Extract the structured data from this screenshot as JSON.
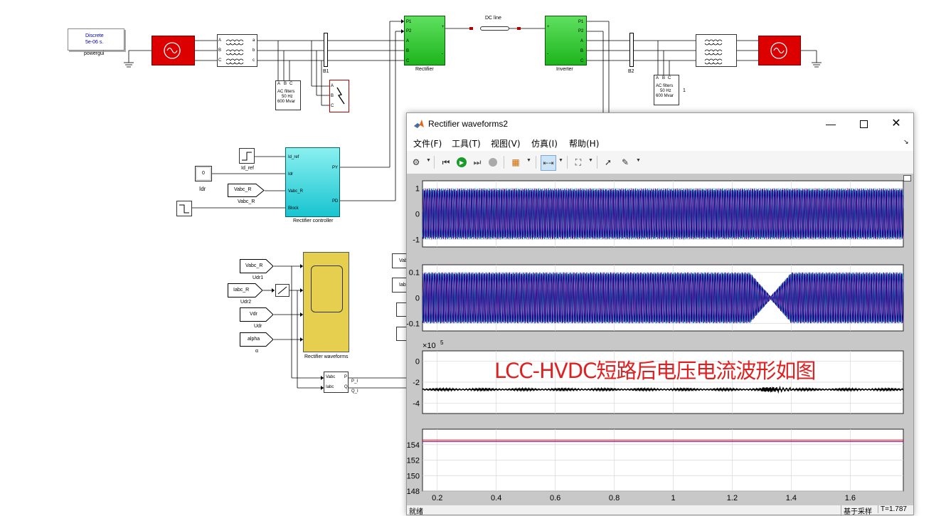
{
  "model": {
    "powergui": {
      "line1": "Discrete",
      "line2": "5e-06 s.",
      "name": "powergui"
    },
    "dc_line_label": "DC line",
    "rectifier_label": "Rectifier",
    "inverter_label": "Inverter",
    "b1_label": "B1",
    "b2_label": "B2",
    "ac_filter_left": {
      "line1": "AC filters",
      "line2": "50 Hz",
      "line3": "600 Mvar",
      "ports": [
        "A",
        "B",
        "C"
      ]
    },
    "ac_filter_right": {
      "line1": "AC filters",
      "line2": "50 Hz",
      "line3": "600 Mvar",
      "ports": [
        "A",
        "B",
        "C"
      ],
      "side": "1"
    },
    "fault_ports": [
      "A",
      "B",
      "C"
    ],
    "rect_ports_left": [
      "P1",
      "P2",
      "A",
      "B",
      "C"
    ],
    "rect_ports_right": [
      "+",
      "-"
    ],
    "inv_ports_left": [
      "+",
      "-"
    ],
    "inv_ports_right": [
      "P1",
      "P2",
      "A",
      "B",
      "C"
    ],
    "transformer_ports": [
      "A",
      "B",
      "C",
      "a",
      "b",
      "c"
    ],
    "source_ports": [
      "A",
      "B",
      "C"
    ],
    "id_ref": "Id_ref",
    "idr_display": {
      "value": "0",
      "label": "Idr"
    },
    "vabc_r_goto": {
      "text": "Vabc_R",
      "label": "Vabc_R"
    },
    "controller": {
      "name": "Rectifier controller",
      "inputs": [
        "Id_ref",
        "Idr",
        "Vabc_R",
        "Block"
      ],
      "outputs": [
        "PY",
        "PD"
      ]
    },
    "from_blocks": [
      {
        "text": "Vabc_R",
        "label": "Udr1"
      },
      {
        "text": "Iabc_R",
        "label": "Udr2"
      },
      {
        "text": "Vdr",
        "label": "Udr"
      },
      {
        "text": "alpha",
        "label": "α"
      }
    ],
    "scope_name": "Rectifier waveforms",
    "pq_block": {
      "inputs": [
        "Vabc",
        "Iabc"
      ],
      "outputs": [
        "P",
        "Q"
      ],
      "out_labels": [
        "P_I",
        "Q_I"
      ]
    },
    "partial_from": [
      "Vab",
      "Iab"
    ]
  },
  "window": {
    "title": "Rectifier waveforms2",
    "menus": [
      "文件(F)",
      "工具(T)",
      "视图(V)",
      "仿真(I)",
      "帮助(H)"
    ],
    "status_left": "就绪",
    "status_mid": "基于采样",
    "status_right": "T=1.787"
  },
  "overlay_text": "LCC-HVDC短路后电压电流波形如图",
  "chart_data": [
    {
      "type": "line",
      "title": "",
      "ylim": [
        -1.3,
        1.3
      ],
      "yticks": [
        "1",
        "0",
        "-1"
      ],
      "series_colors": [
        "#00c0c0",
        "#8000a0",
        "#000080"
      ],
      "description_values": {
        "amplitude": 1.0
      }
    },
    {
      "type": "line",
      "title": "",
      "ylim": [
        -0.13,
        0.13
      ],
      "yticks": [
        "0.1",
        "0",
        "-0.1"
      ],
      "series_colors": [
        "#00c0c0",
        "#8000a0",
        "#000080"
      ],
      "description_values": {
        "amplitude_before": 0.1,
        "dip_center_x": 1.33,
        "dip_min_amplitude": 0.005
      }
    },
    {
      "type": "line",
      "title": "",
      "ylim": [
        -5,
        1
      ],
      "yticks": [
        "0",
        "-2",
        "-4"
      ],
      "exponent_label": "×10",
      "exponent_power": "5",
      "series": [
        {
          "name": "",
          "values_x": [
            0.15,
            1.3,
            1.4,
            1.78
          ],
          "values_y": [
            -2.7,
            -2.7,
            -2.6,
            -2.7
          ]
        }
      ]
    },
    {
      "type": "line",
      "title": "",
      "ylim": [
        148,
        156
      ],
      "yticks": [
        "154",
        "152",
        "150",
        "148"
      ],
      "xticks": [
        "0.2",
        "0.4",
        "0.6",
        "0.8",
        "1",
        "1.2",
        "1.4",
        "1.6"
      ],
      "xlim": [
        0.15,
        1.78
      ],
      "series": [
        {
          "name": "",
          "color": "#ff0000",
          "values_x": [
            0.15,
            1.78
          ],
          "values_y": [
            154.6,
            154.6
          ]
        },
        {
          "name": "",
          "color": "#8000a0",
          "values_x": [
            0.15,
            1.78
          ],
          "values_y": [
            154.4,
            154.4
          ]
        }
      ]
    }
  ],
  "colors": {
    "source_red": "#dd0000",
    "rect_green": "#1db51d",
    "controller_cyan": "#40d8e0",
    "scope_yellow": "#e8d050",
    "overlay_red": "#e02020"
  }
}
